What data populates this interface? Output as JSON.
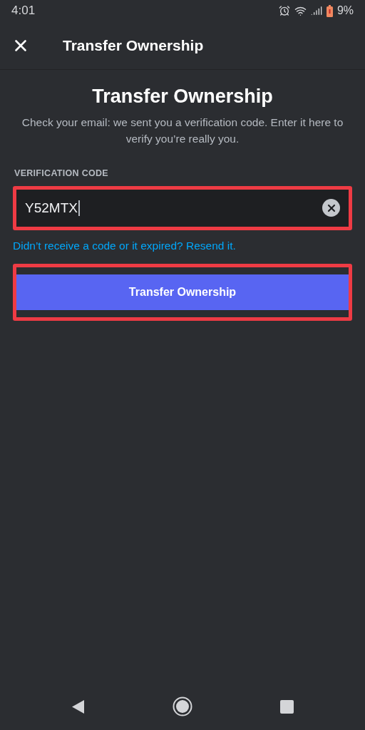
{
  "status_bar": {
    "time": "4:01",
    "battery": "9%"
  },
  "header": {
    "title": "Transfer Ownership"
  },
  "heading": "Transfer Ownership",
  "description": "Check your email: we sent you a verification code. Enter it here to verify you’re really you.",
  "field": {
    "label": "VERIFICATION CODE",
    "value": "Y52MTX",
    "highlighted": true
  },
  "resend_link": "Didn’t receive a code or it expired? Resend it.",
  "button": {
    "label": "Transfer Ownership",
    "highlighted": true
  }
}
